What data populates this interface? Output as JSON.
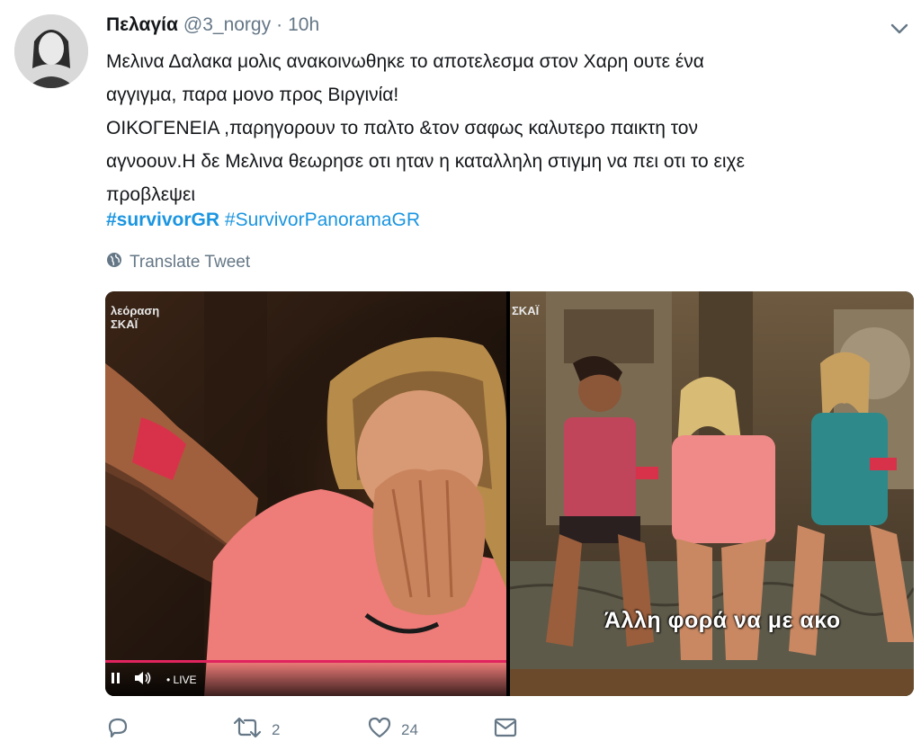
{
  "tweet": {
    "author_name": "Πελαγία",
    "handle": "@3_norgy",
    "separator": "·",
    "time": "10h",
    "text_lines": [
      "Μελινα Δαλακα μολις ανακοινωθηκε το αποτελεσμα στον Χαρη ουτε ένα",
      "αγγιγμα, παρα μονο προς Βιργινία!",
      "ΟΙΚΟΓΕΝΕΙΑ ,παρηγορουν το παλτο &τον σαφως καλυτερο παικτη τον",
      "αγνοουν.Η δε Μελινα θεωρησε οτι ηταν η καταλληλη στιγμη να πει οτι το ειχε",
      "προβλεψει"
    ],
    "hashtags": [
      "#survivorGR",
      "#SurvivorPanoramaGR"
    ],
    "translate_label": "Translate Tweet"
  },
  "media": {
    "left_watermark_line1": "λεόραση",
    "left_watermark_line2": "ΣΚΑΪ",
    "right_watermark": "ΣΚΑΪ",
    "live_label": "• LIVE",
    "caption": "Άλλη φορά να με ακο"
  },
  "actions": {
    "reply_count": "",
    "retweet_count": "2",
    "like_count": "24"
  },
  "colors": {
    "link": "#1b95e0",
    "muted": "#657786",
    "progress": "#e0245e"
  }
}
